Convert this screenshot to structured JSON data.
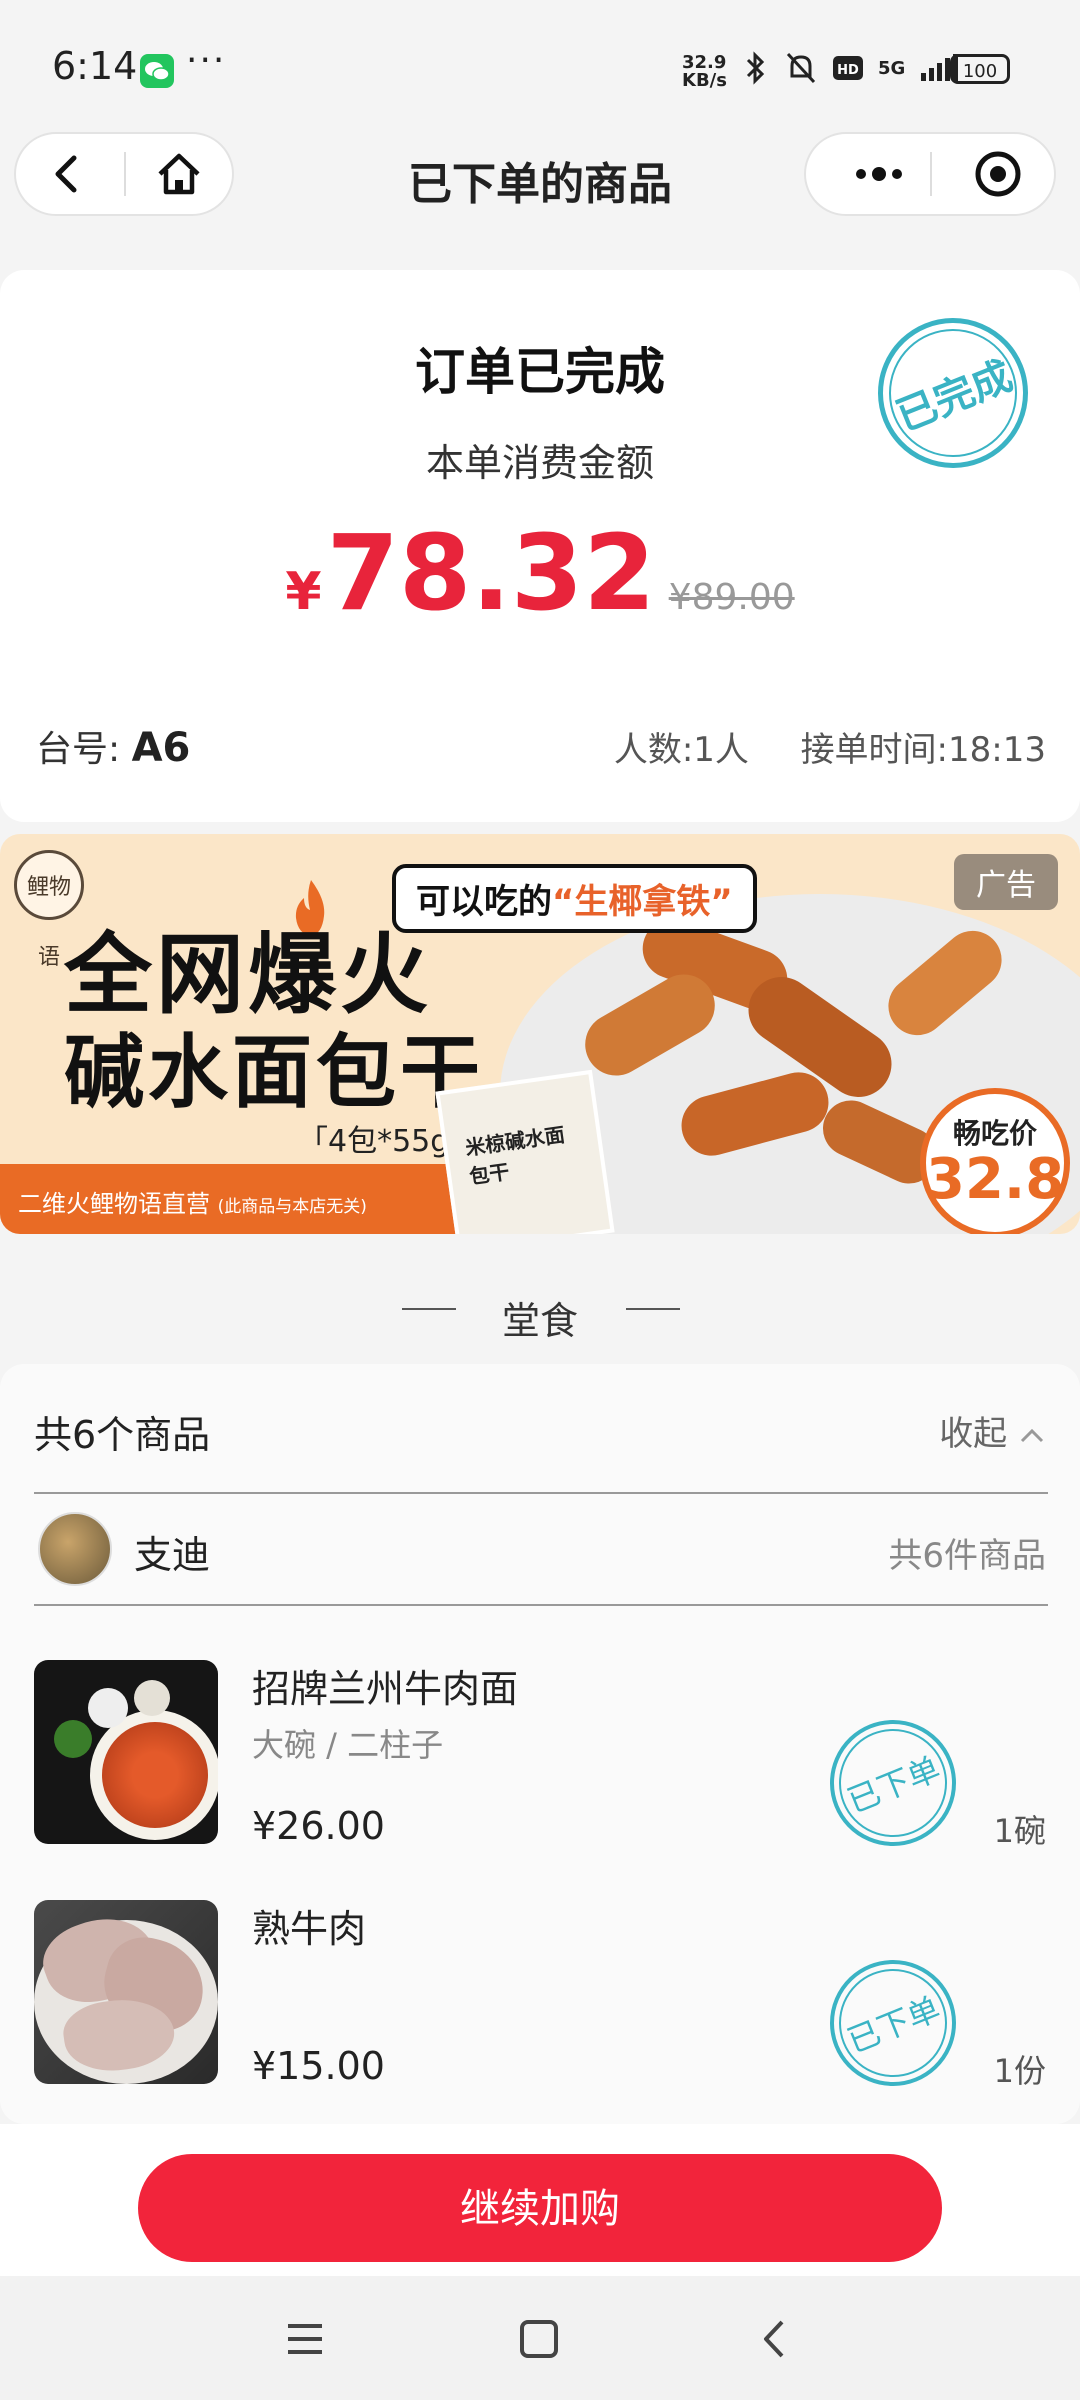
{
  "status_bar": {
    "time": "6:14",
    "dots": "···",
    "net_speed_value": "32.9",
    "net_speed_unit": "KB/s",
    "battery": "100",
    "signal": "5G"
  },
  "nav": {
    "title": "已下单的商品"
  },
  "order": {
    "status": "订单已完成",
    "amount_label": "本单消费金额",
    "currency": "¥",
    "amount": "78.32",
    "original_price": "¥89.00",
    "stamp_text": "已完成",
    "table_label": "台号:",
    "table_value": "A6",
    "people": "人数:1人",
    "order_time": "接单时间:18:13"
  },
  "ad": {
    "logo": "鲤物语",
    "headline": "全网爆火",
    "subhead": "碱水面包干",
    "spec": "「4包*55g」",
    "callout_prefix": "可以吃的",
    "callout_highlight": "“生椰拿铁”",
    "footnote": "二维火鲤物语直营",
    "footnote_small": "(此商品与本店无关)",
    "pack_label": "米椋碱水面包干",
    "tag": "广告",
    "price_label": "畅吃价",
    "price_value": "32.8"
  },
  "section": {
    "heading": "堂食"
  },
  "items": {
    "count_label": "共6个商品",
    "collapse_label": "收起",
    "user": {
      "name": "支迪",
      "count": "共6件商品"
    },
    "list": [
      {
        "name": "招牌兰州牛肉面",
        "spec": "大碗 / 二柱子",
        "price": "¥26.00",
        "qty": "1碗",
        "stamp": "已下单"
      },
      {
        "name": "熟牛肉",
        "spec": "",
        "price": "¥15.00",
        "qty": "1份",
        "stamp": "已下单"
      }
    ]
  },
  "cta": {
    "label": "继续加购"
  },
  "colors": {
    "accent_red": "#f2243b",
    "price_red": "#e8243b",
    "stamp_teal": "#3ab3c4",
    "ad_orange": "#e96b25"
  }
}
